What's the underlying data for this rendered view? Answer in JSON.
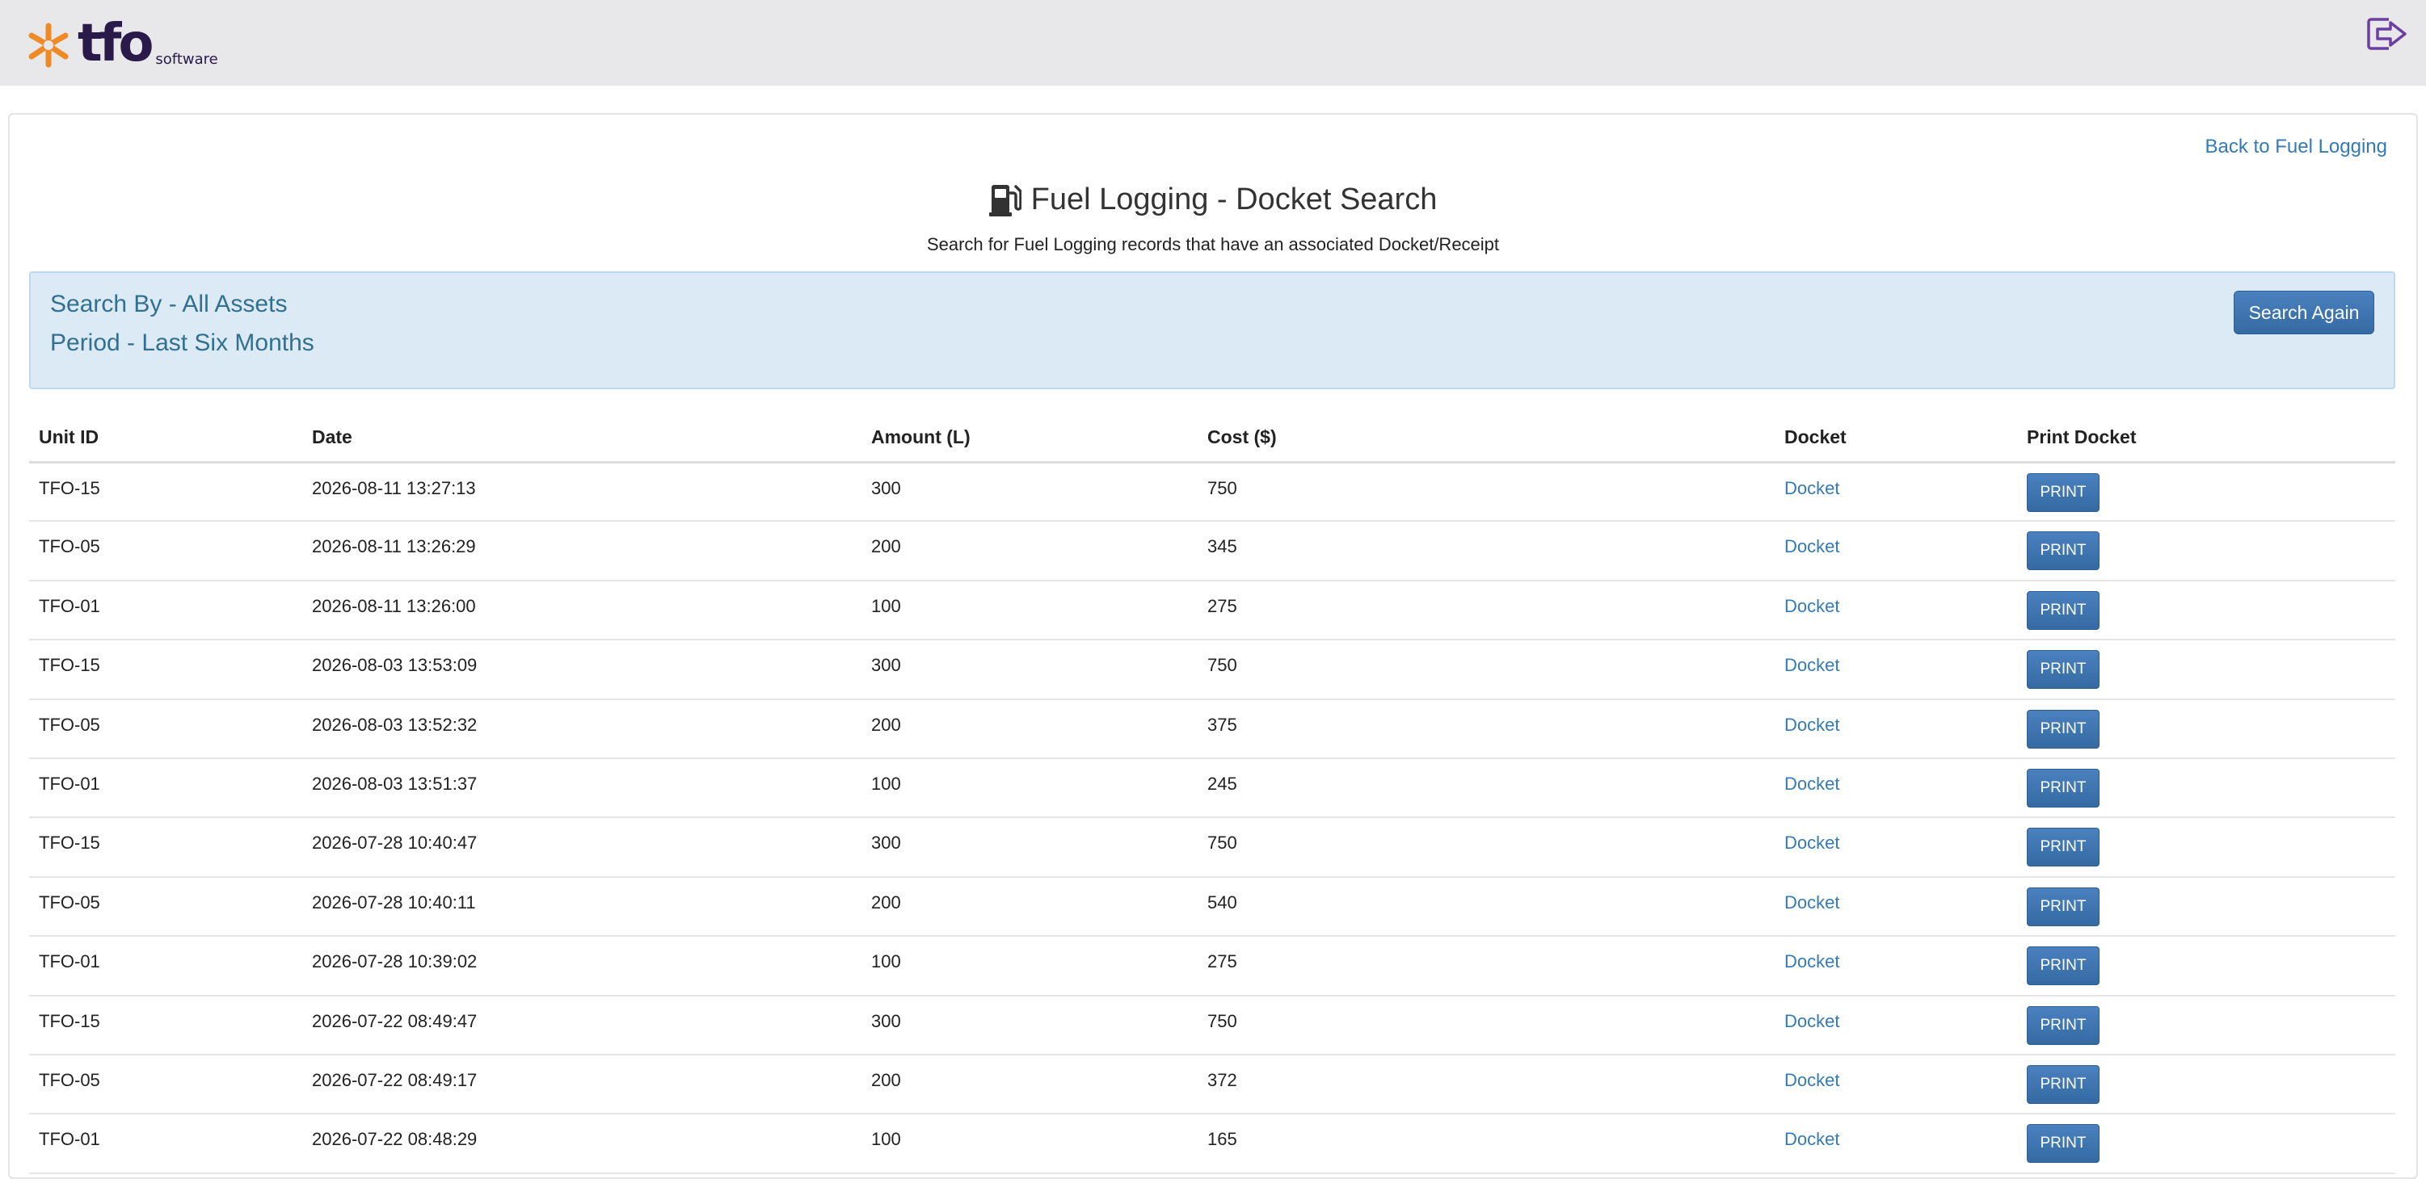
{
  "header": {
    "logo_text": "tfo",
    "logo_sub": "software",
    "brand_orange": "#f08a24",
    "brand_purple": "#2a1a4a",
    "logout_icon": "logout-icon"
  },
  "page": {
    "back_link": "Back to Fuel Logging",
    "title": "Fuel Logging - Docket Search",
    "title_icon": "gas-pump-icon",
    "subtitle": "Search for Fuel Logging records that have an associated Docket/Receipt"
  },
  "search_info": {
    "search_by": "Search By - All Assets",
    "period": "Period - Last Six Months",
    "button_label": "Search Again"
  },
  "table": {
    "headers": [
      "Unit ID",
      "Date",
      "Amount (L)",
      "Cost ($)",
      "Docket",
      "Print Docket"
    ],
    "rows": [
      {
        "unit": "TFO-15",
        "date": "2026-08-11 13:27:13",
        "amount": "300",
        "cost": "750",
        "docket": "Docket",
        "print": "PRINT"
      },
      {
        "unit": "TFO-05",
        "date": "2026-08-11 13:26:29",
        "amount": "200",
        "cost": "345",
        "docket": "Docket",
        "print": "PRINT"
      },
      {
        "unit": "TFO-01",
        "date": "2026-08-11 13:26:00",
        "amount": "100",
        "cost": "275",
        "docket": "Docket",
        "print": "PRINT"
      },
      {
        "unit": "TFO-15",
        "date": "2026-08-03 13:53:09",
        "amount": "300",
        "cost": "750",
        "docket": "Docket",
        "print": "PRINT"
      },
      {
        "unit": "TFO-05",
        "date": "2026-08-03 13:52:32",
        "amount": "200",
        "cost": "375",
        "docket": "Docket",
        "print": "PRINT"
      },
      {
        "unit": "TFO-01",
        "date": "2026-08-03 13:51:37",
        "amount": "100",
        "cost": "245",
        "docket": "Docket",
        "print": "PRINT"
      },
      {
        "unit": "TFO-15",
        "date": "2026-07-28 10:40:47",
        "amount": "300",
        "cost": "750",
        "docket": "Docket",
        "print": "PRINT"
      },
      {
        "unit": "TFO-05",
        "date": "2026-07-28 10:40:11",
        "amount": "200",
        "cost": "540",
        "docket": "Docket",
        "print": "PRINT"
      },
      {
        "unit": "TFO-01",
        "date": "2026-07-28 10:39:02",
        "amount": "100",
        "cost": "275",
        "docket": "Docket",
        "print": "PRINT"
      },
      {
        "unit": "TFO-15",
        "date": "2026-07-22 08:49:47",
        "amount": "300",
        "cost": "750",
        "docket": "Docket",
        "print": "PRINT"
      },
      {
        "unit": "TFO-05",
        "date": "2026-07-22 08:49:17",
        "amount": "200",
        "cost": "372",
        "docket": "Docket",
        "print": "PRINT"
      },
      {
        "unit": "TFO-01",
        "date": "2026-07-22 08:48:29",
        "amount": "100",
        "cost": "165",
        "docket": "Docket",
        "print": "PRINT"
      }
    ]
  }
}
